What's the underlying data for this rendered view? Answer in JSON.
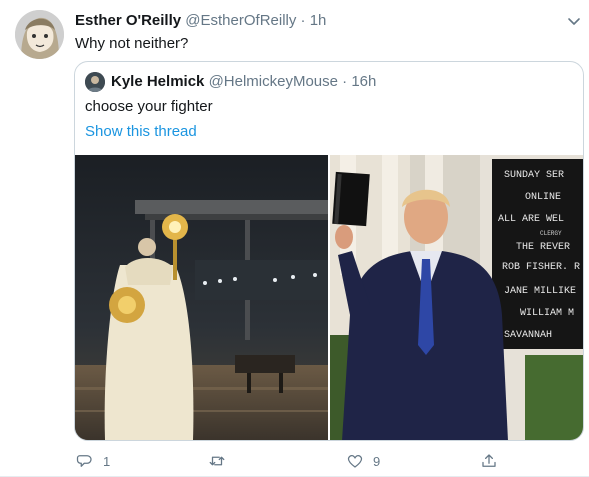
{
  "tweet": {
    "author": {
      "display_name": "Esther O'Reilly",
      "handle": "@EstherOfReilly",
      "separator": "·",
      "time": "1h"
    },
    "text": "Why not neither?",
    "menu_icon": "chevron-down-icon"
  },
  "quoted_tweet": {
    "author": {
      "display_name": "Kyle Helmick",
      "handle": "@HelmickeyMouse",
      "separator": "·",
      "time": "16h"
    },
    "text": "choose your fighter",
    "show_thread_label": "Show this thread",
    "photos": {
      "right_sign_lines": [
        "SUNDAY SER",
        "ONLINE",
        "ALL ARE WEL",
        "CLERGY",
        "THE REVER",
        "ROB FISHER. R",
        "JANE MILLIKE",
        "WILLIAM M",
        "SAVANNAH"
      ]
    }
  },
  "actions": {
    "reply": {
      "icon": "reply-icon",
      "count": "1"
    },
    "retweet": {
      "icon": "retweet-icon",
      "count": ""
    },
    "like": {
      "icon": "heart-icon",
      "count": "9"
    },
    "share": {
      "icon": "share-icon",
      "count": ""
    }
  },
  "colors": {
    "link": "#1b95e0",
    "secondary_text": "#657786",
    "border": "#ccd6dd"
  }
}
